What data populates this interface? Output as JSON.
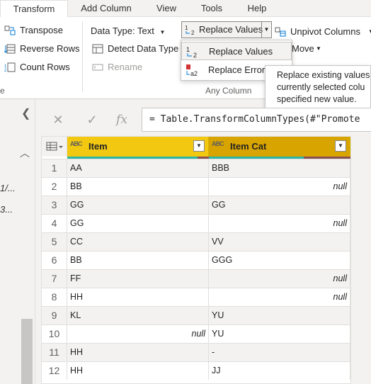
{
  "tabs": [
    {
      "label": "Transform",
      "active": true
    },
    {
      "label": "Add Column",
      "active": false
    },
    {
      "label": "View",
      "active": false
    },
    {
      "label": "Tools",
      "active": false
    },
    {
      "label": "Help",
      "active": false
    }
  ],
  "ribbon": {
    "table_group": {
      "transpose": "Transpose",
      "reverse_rows": "Reverse Rows",
      "count_rows": "Count Rows",
      "group_label_fragment": "e"
    },
    "any_column": {
      "data_type": "Data Type: Text",
      "detect_data_type": "Detect Data Type",
      "rename": "Rename",
      "replace_values": "Replace Values",
      "unpivot_columns": "Unpivot Columns",
      "move": "Move",
      "group_label": "Any Column"
    },
    "dropdown": {
      "replace_values": "Replace Values",
      "replace_errors": "Replace Errors"
    },
    "tooltip": {
      "line1": "Replace existing values",
      "line2": "currently selected colu",
      "line3": "specified new value."
    }
  },
  "left_panel": {
    "query1": "1/...",
    "query2": "3..."
  },
  "formula_bar": {
    "cancel_glyph": "✕",
    "commit_glyph": "✓",
    "fx_glyph": "fx",
    "formula": "= Table.TransformColumnTypes(#\"Promote"
  },
  "table": {
    "type_badge": "ABC",
    "columns": [
      "Item",
      "Item Cat"
    ],
    "rows": [
      {
        "n": "1",
        "item": "AA",
        "cat": "BBB"
      },
      {
        "n": "2",
        "item": "BB",
        "cat": "null"
      },
      {
        "n": "3",
        "item": "GG",
        "cat": "GG"
      },
      {
        "n": "4",
        "item": "GG",
        "cat": "null"
      },
      {
        "n": "5",
        "item": "CC",
        "cat": "VV"
      },
      {
        "n": "6",
        "item": "BB",
        "cat": "GGG"
      },
      {
        "n": "7",
        "item": "FF",
        "cat": "null"
      },
      {
        "n": "8",
        "item": "HH",
        "cat": "null"
      },
      {
        "n": "9",
        "item": "KL",
        "cat": "YU"
      },
      {
        "n": "10",
        "item": "null",
        "cat": "YU"
      },
      {
        "n": "11",
        "item": "HH",
        "cat": "-"
      },
      {
        "n": "12",
        "item": "HH",
        "cat": "JJ"
      }
    ]
  },
  "colors": {
    "header_yellow": "#f2c811",
    "quality_valid": "#2fb5a5",
    "quality_empty": "#8a4f4f",
    "accent": "#f2c811"
  }
}
